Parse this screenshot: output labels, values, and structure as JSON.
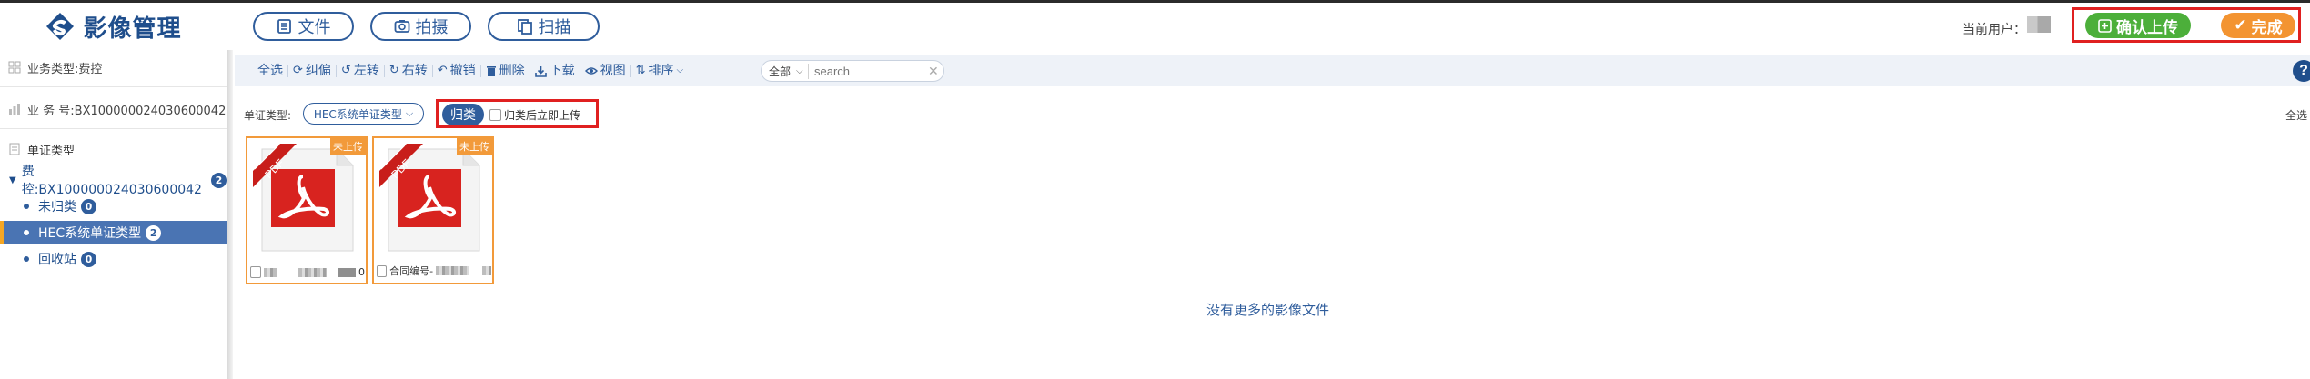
{
  "header": {
    "app_title": "影像管理",
    "tabs": [
      {
        "label": "文件",
        "icon": "file-icon"
      },
      {
        "label": "拍摄",
        "icon": "camera-icon"
      },
      {
        "label": "扫描",
        "icon": "scan-icon"
      }
    ],
    "current_user_label": "当前用户：",
    "confirm_upload_label": "确认上传",
    "done_label": "完成"
  },
  "sidebar": {
    "business_type": "业务类型:费控",
    "business_no": "业 务 号:BX100000024030600042",
    "doc_type_title": "单证类型",
    "tree": {
      "root_label": "费控:BX100000024030600042",
      "root_count": "2",
      "children": [
        {
          "label": "未归类",
          "count": "0"
        },
        {
          "label": "HEC系统单证类型",
          "count": "2",
          "active": true
        },
        {
          "label": "回收站",
          "count": "0"
        }
      ]
    }
  },
  "toolbar": {
    "items": [
      {
        "label": "全选",
        "icon": ""
      },
      {
        "label": "纠偏",
        "icon": "rotate-icon"
      },
      {
        "label": "左转",
        "icon": "rotate-left-icon"
      },
      {
        "label": "右转",
        "icon": "rotate-right-icon"
      },
      {
        "label": "撤销",
        "icon": "undo-icon"
      },
      {
        "label": "删除",
        "icon": "trash-icon"
      },
      {
        "label": "下载",
        "icon": "download-icon"
      },
      {
        "label": "视图",
        "icon": "eye-icon"
      },
      {
        "label": "排序",
        "icon": "sort-icon"
      }
    ],
    "filter_scope": "全部",
    "search_placeholder": "search",
    "search_value": ""
  },
  "classify_bar": {
    "type_label": "单证类型:",
    "type_value": "HEC系统单证类型",
    "classify_button": "归类",
    "auto_upload_label": "归类后立即上传",
    "select_all_right": "全选"
  },
  "files": [
    {
      "type": "PDF",
      "status": "未上传",
      "caption_tail": "0"
    },
    {
      "type": "PDF",
      "status": "未上传",
      "caption_prefix": "合同编号-"
    }
  ],
  "empty_message": "没有更多的影像文件",
  "colors": {
    "primary": "#2f5d9c",
    "confirm_green": "#4caf3a",
    "done_orange": "#f39431",
    "card_border": "#f29a3a",
    "highlight_red": "#e02020",
    "pdf_red": "#d8231f"
  }
}
